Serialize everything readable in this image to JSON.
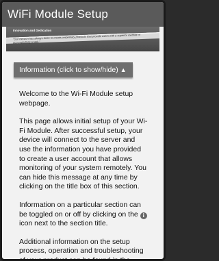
{
  "header": {
    "title": "WiFi Module Setup"
  },
  "banner": {
    "kicker": "Innovation and Dedication",
    "mission": "\"Our mission has always been to create proprietary products that provide users with a superior method of accomplishing a task.\""
  },
  "info_section": {
    "toggle_label": "Information (click to show/hide)",
    "toggle_arrow": "▲",
    "paragraphs": [
      "Welcome to the Wi-Fi Module setup webpage.",
      "This page allows initial setup of your Wi-Fi Module. After successful setup, your device will connect to the server and use the information you have provided to create a user account that allows monitoring of your system remotely. You can hide this message at any time by clicking on the title box of this section.",
      "Additional information on the setup process, operation and troubleshooting of your product can be found in the"
    ],
    "toggle_para_before": "Information on a particular section can be toggled on or off by clicking on the",
    "toggle_para_icon": "i",
    "toggle_para_after": "icon next to the section title."
  }
}
